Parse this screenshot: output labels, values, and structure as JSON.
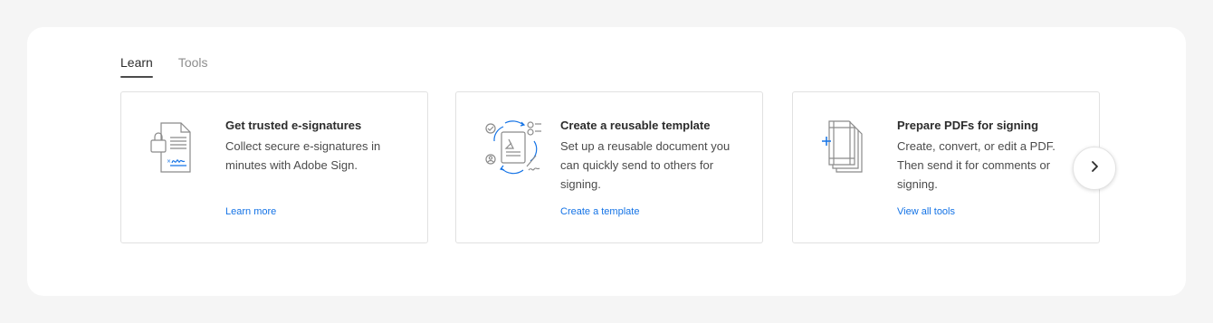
{
  "tabs": [
    {
      "label": "Learn",
      "active": true
    },
    {
      "label": "Tools",
      "active": false
    }
  ],
  "cards": [
    {
      "icon": "e-signature-document-icon",
      "title": "Get trusted e-signatures",
      "body": "Collect secure e-signatures in minutes with Adobe Sign.",
      "link": "Learn more"
    },
    {
      "icon": "reusable-template-icon",
      "title": "Create a reusable template",
      "body": "Set up a reusable document you can quickly send to others for signing.",
      "link": "Create a template"
    },
    {
      "icon": "prepare-pdf-pages-icon",
      "title": "Prepare PDFs for signing",
      "body": "Create, convert, or edit a PDF. Then send it for comments or signing.",
      "link": "View all tools"
    }
  ],
  "carousel": {
    "next_icon": "chevron-right-icon"
  },
  "colors": {
    "accent": "#1473e6",
    "icon_stroke": "#8a8a8a"
  }
}
